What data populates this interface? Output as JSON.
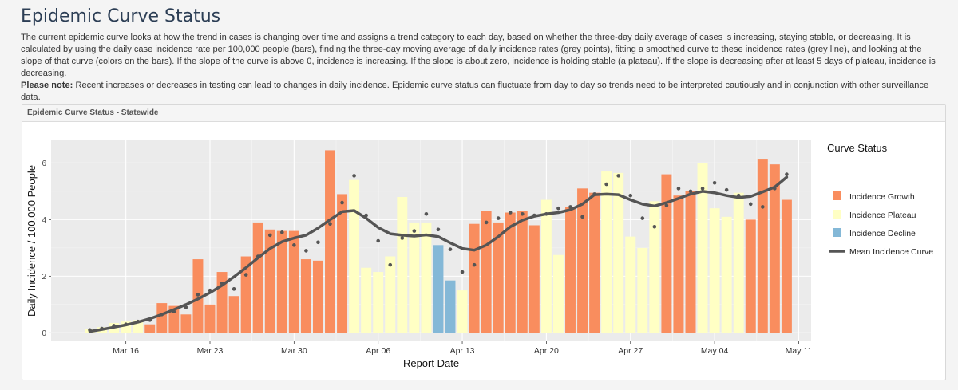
{
  "page": {
    "title": "Epidemic Curve Status",
    "description": "The current epidemic curve looks at how the trend in cases is changing over time and assigns a trend category to each day, based on whether the three-day daily average of cases is increasing, staying stable, or decreasing. It is calculated by using the daily case incidence rate per 100,000 people (bars), finding the three-day moving average of daily incidence rates (grey points), fitting a smoothed curve to these incidence rates (grey line), and looking at the slope of that curve (colors on the bars). If the slope of the curve is above 0, incidence is increasing. If the slope is about zero, incidence is holding stable (a plateau). If the slope is decreasing after at least 5 days of plateau, incidence is decreasing.",
    "note_label": "Please note:",
    "note_text": " Recent increases or decreases in testing can lead to changes in daily incidence. Epidemic curve status can fluctuate from day to day so trends need to be interpreted cautiously and in conjunction with other surveillance data."
  },
  "panel": {
    "title": "Epidemic Curve Status - Statewide"
  },
  "colors": {
    "growth": "#f98d5e",
    "plateau": "#ffffc4",
    "decline": "#84b8d7",
    "curve": "#555555",
    "points": "#555555",
    "plot_bg": "#ebebeb"
  },
  "chart_data": {
    "type": "bar",
    "xlabel": "Report Date",
    "ylabel": "Daily Incidence / 100,000 People",
    "x_ticks": [
      "Mar 16",
      "Mar 23",
      "Mar 30",
      "Apr 06",
      "Apr 13",
      "Apr 20",
      "Apr 27",
      "May 04",
      "May 11"
    ],
    "y_ticks": [
      "0",
      "2",
      "4",
      "6"
    ],
    "ylim": [
      -0.3,
      6.8
    ],
    "grid": true,
    "legend": {
      "title": "Curve Status",
      "position": "right",
      "items": [
        "Incidence Growth",
        "Incidence Plateau",
        "Incidence Decline",
        "Mean Incidence Curve"
      ]
    },
    "dates": [
      "Mar 13",
      "Mar 14",
      "Mar 15",
      "Mar 16",
      "Mar 17",
      "Mar 18",
      "Mar 19",
      "Mar 20",
      "Mar 21",
      "Mar 22",
      "Mar 23",
      "Mar 24",
      "Mar 25",
      "Mar 26",
      "Mar 27",
      "Mar 28",
      "Mar 29",
      "Mar 30",
      "Mar 31",
      "Apr 01",
      "Apr 02",
      "Apr 03",
      "Apr 04",
      "Apr 05",
      "Apr 06",
      "Apr 07",
      "Apr 08",
      "Apr 09",
      "Apr 10",
      "Apr 11",
      "Apr 12",
      "Apr 13",
      "Apr 14",
      "Apr 15",
      "Apr 16",
      "Apr 17",
      "Apr 18",
      "Apr 19",
      "Apr 20",
      "Apr 21",
      "Apr 22",
      "Apr 23",
      "Apr 24",
      "Apr 25",
      "Apr 26",
      "Apr 27",
      "Apr 28",
      "Apr 29",
      "Apr 30",
      "May 01",
      "May 02",
      "May 03",
      "May 04",
      "May 05",
      "May 06",
      "May 07",
      "May 08",
      "May 09",
      "May 10"
    ],
    "bars": [
      0.15,
      0.2,
      0.35,
      0.4,
      0.45,
      0.3,
      1.05,
      0.95,
      0.65,
      2.6,
      1.0,
      2.15,
      1.3,
      2.7,
      3.9,
      3.65,
      3.6,
      3.6,
      2.6,
      2.55,
      6.45,
      4.9,
      5.4,
      2.3,
      2.15,
      2.7,
      4.8,
      3.9,
      3.9,
      3.1,
      1.85,
      1.5,
      3.85,
      4.3,
      3.9,
      4.25,
      4.3,
      3.8,
      4.7,
      2.75,
      4.45,
      5.1,
      4.95,
      5.7,
      5.65,
      3.4,
      3.0,
      4.65,
      5.6,
      4.85,
      5.0,
      6.0,
      4.4,
      4.1,
      4.95,
      4.0,
      6.15,
      5.95,
      4.7
    ],
    "status": [
      "P",
      "P",
      "P",
      "P",
      "P",
      "G",
      "G",
      "G",
      "G",
      "G",
      "G",
      "G",
      "G",
      "G",
      "G",
      "G",
      "G",
      "G",
      "G",
      "G",
      "G",
      "G",
      "P",
      "P",
      "P",
      "P",
      "P",
      "P",
      "P",
      "D",
      "D",
      "P",
      "G",
      "G",
      "G",
      "G",
      "G",
      "G",
      "P",
      "P",
      "G",
      "G",
      "G",
      "P",
      "P",
      "P",
      "P",
      "P",
      "G",
      "G",
      "G",
      "P",
      "P",
      "P",
      "P",
      "G",
      "G",
      "G",
      "G"
    ],
    "avg_points": [
      0.1,
      0.15,
      0.25,
      0.3,
      0.4,
      0.45,
      0.65,
      0.75,
      0.9,
      1.35,
      1.5,
      1.75,
      1.55,
      2.05,
      2.7,
      3.45,
      3.55,
      3.1,
      2.9,
      3.2,
      3.85,
      4.6,
      5.55,
      4.15,
      3.25,
      2.4,
      3.35,
      3.6,
      4.2,
      3.65,
      2.95,
      2.15,
      2.4,
      3.9,
      4.05,
      4.25,
      4.2,
      4.15,
      4.2,
      4.4,
      4.45,
      4.1,
      4.9,
      5.25,
      5.55,
      4.85,
      4.05,
      3.75,
      4.5,
      5.1,
      5.0,
      5.1,
      5.3,
      5.05,
      4.85,
      4.55,
      4.45,
      5.1,
      5.6
    ],
    "mean_curve": [
      0.05,
      0.12,
      0.2,
      0.28,
      0.38,
      0.5,
      0.65,
      0.82,
      1.0,
      1.2,
      1.42,
      1.68,
      1.98,
      2.3,
      2.65,
      2.98,
      3.22,
      3.35,
      3.45,
      3.7,
      4.0,
      4.28,
      4.32,
      4.05,
      3.72,
      3.5,
      3.45,
      3.42,
      3.46,
      3.4,
      3.18,
      2.98,
      2.92,
      3.1,
      3.4,
      3.75,
      3.98,
      4.12,
      4.2,
      4.25,
      4.35,
      4.55,
      4.88,
      4.9,
      4.88,
      4.7,
      4.55,
      4.48,
      4.6,
      4.75,
      4.9,
      5.0,
      4.95,
      4.85,
      4.78,
      4.82,
      4.98,
      5.15,
      5.5
    ]
  }
}
